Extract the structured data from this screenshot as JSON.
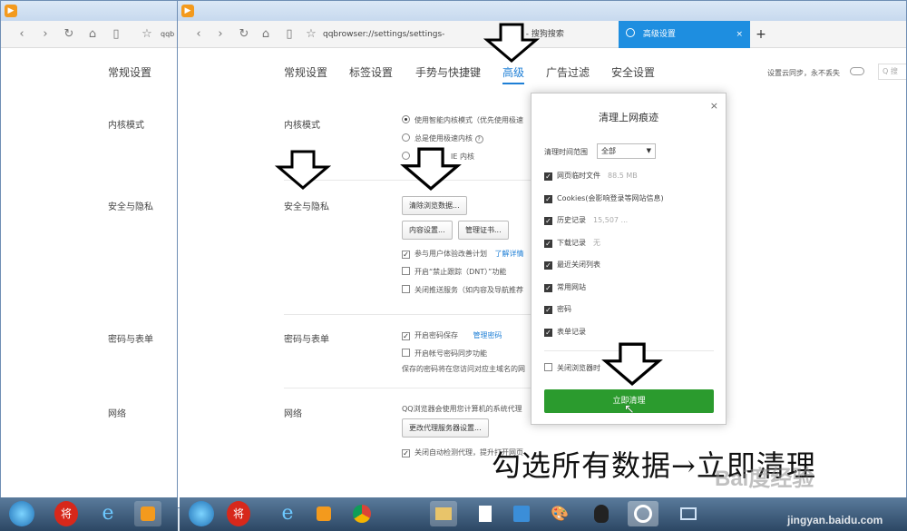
{
  "browser": {
    "address_text": "qqbrowser://settings/settings-",
    "back_win_address": "qqb",
    "tabs": [
      "8.0.1 - 搜狗搜索",
      "高级设置"
    ],
    "new_tab": "+",
    "tab_close": "×"
  },
  "menu": [
    "常规设置",
    "标签设置",
    "手势与快捷键",
    "高级",
    "广告过滤",
    "安全设置"
  ],
  "back_menu_label": "常规设置",
  "sync": {
    "label": "设置云同步，永不丢失",
    "search_placeholder": "Q 搜"
  },
  "sections": {
    "kernel": {
      "title": "内核模式",
      "options": [
        "使用智能内核模式（优先使用极速",
        "总是使用极速内核",
        "IE 内核"
      ]
    },
    "security": {
      "title": "安全与隐私",
      "clear_button": "清除浏览数据...",
      "content_button": "内容设置...",
      "cert_button": "管理证书...",
      "options": [
        "参与用户体验改善计划",
        "开启“禁止跟踪（DNT）”功能",
        "关闭推送服务（如内容及导航推荐"
      ],
      "learn_more": "了解详情"
    },
    "password": {
      "title": "密码与表单",
      "options": [
        "开启密码保存",
        "开启帐号密码同步功能"
      ],
      "manage_link": "管理密码",
      "note": "保存的密码将在您访问对应主域名的网"
    },
    "network": {
      "title": "网络",
      "note": "QQ浏览器会使用您计算机的系统代理",
      "proxy_button": "更改代理服务器设置...",
      "auto_proxy": "关闭自动检测代理，提升打开网页"
    }
  },
  "back_sections": [
    "内核模式",
    "安全与隐私",
    "密码与表单",
    "网络"
  ],
  "dialog": {
    "title": "清理上网痕迹",
    "close": "×",
    "range_label": "清理时间范围",
    "range_value": "全部",
    "items": [
      {
        "label": "网页临时文件",
        "extra": "88.5 MB"
      },
      {
        "label": "Cookies(会影响登录等网站信息)",
        "extra": ""
      },
      {
        "label": "历史记录",
        "extra": "15,507 ..."
      },
      {
        "label": "下载记录",
        "extra": "无"
      },
      {
        "label": "最近关闭列表",
        "extra": ""
      },
      {
        "label": "常用网站",
        "extra": ""
      },
      {
        "label": "密码",
        "extra": ""
      },
      {
        "label": "表单记录",
        "extra": ""
      }
    ],
    "close_browser_option": "关闭浏览器时",
    "clear_button": "立即清理"
  },
  "caption": "勾选所有数据→立即清理",
  "watermark": {
    "brand": "Bai度经验",
    "url": "jingyan.baidu.com"
  },
  "colors": {
    "accent": "#1e7fd6",
    "green": "#2b9b2e",
    "tab_active": "#1e8ee0"
  }
}
